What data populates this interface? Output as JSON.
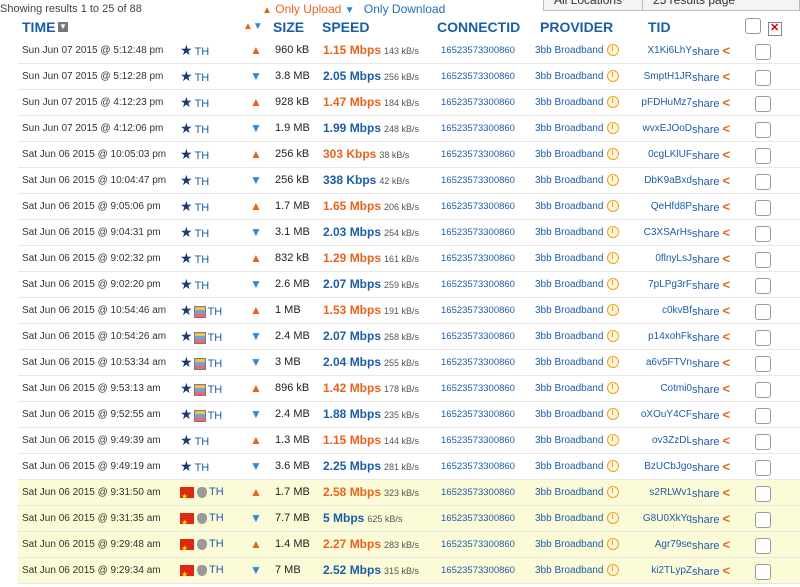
{
  "topbar": {
    "showing": "Showing results 1 to 25 of 88",
    "only_upload": "Only Upload",
    "only_download": "Only Download",
    "btn1": "All Locations",
    "btn2": "25 results page"
  },
  "header": {
    "time": "TIME",
    "size": "SIZE",
    "speed": "SPEED",
    "connectid": "CONNECTID",
    "provider": "PROVIDER",
    "tid": "TID"
  },
  "colors": {
    "upload": "#e8641b",
    "download": "#1a5ea8",
    "accent": "#1a5ea8",
    "cn_row_bg": "#fbfbd8"
  },
  "rows": [
    {
      "time": "Sun Jun 07 2015 @ 5:12:48 pm",
      "platform": "star",
      "country": "TH",
      "dir": "up",
      "size": "960 kB",
      "speed": "1.15 Mbps",
      "kbs": "143 kB/s",
      "conn": "16523573300860",
      "provider": "3bb Broadband",
      "tid": "X1Ki6LhY",
      "share": "share"
    },
    {
      "time": "Sun Jun 07 2015 @ 5:12:28 pm",
      "platform": "star",
      "country": "TH",
      "dir": "down",
      "size": "3.8 MB",
      "speed": "2.05 Mbps",
      "kbs": "256 kB/s",
      "conn": "16523573300860",
      "provider": "3bb Broadband",
      "tid": "SmptH1JR",
      "share": "share"
    },
    {
      "time": "Sun Jun 07 2015 @ 4:12:23 pm",
      "platform": "star",
      "country": "TH",
      "dir": "up",
      "size": "928 kB",
      "speed": "1.47 Mbps",
      "kbs": "184 kB/s",
      "conn": "16523573300860",
      "provider": "3bb Broadband",
      "tid": "pFDHuMz7",
      "share": "share"
    },
    {
      "time": "Sun Jun 07 2015 @ 4:12:06 pm",
      "platform": "star",
      "country": "TH",
      "dir": "down",
      "size": "1.9 MB",
      "speed": "1.99 Mbps",
      "kbs": "248 kB/s",
      "conn": "16523573300860",
      "provider": "3bb Broadband",
      "tid": "wvxEJOoD",
      "share": "share"
    },
    {
      "time": "Sat Jun 06 2015 @ 10:05:03 pm",
      "platform": "star",
      "country": "TH",
      "dir": "up",
      "size": "256 kB",
      "speed": "303 Kbps",
      "kbs": "38 kB/s",
      "conn": "16523573300860",
      "provider": "3bb Broadband",
      "tid": "0cgLKlUF",
      "share": "share"
    },
    {
      "time": "Sat Jun 06 2015 @ 10:04:47 pm",
      "platform": "star",
      "country": "TH",
      "dir": "down",
      "size": "256 kB",
      "speed": "338 Kbps",
      "kbs": "42 kB/s",
      "conn": "16523573300860",
      "provider": "3bb Broadband",
      "tid": "DbK9aBxd",
      "share": "share"
    },
    {
      "time": "Sat Jun 06 2015 @ 9:05:06 pm",
      "platform": "star",
      "country": "TH",
      "dir": "up",
      "size": "1.7 MB",
      "speed": "1.65 Mbps",
      "kbs": "206 kB/s",
      "conn": "16523573300860",
      "provider": "3bb Broadband",
      "tid": "QeHfd8P",
      "share": "share"
    },
    {
      "time": "Sat Jun 06 2015 @ 9:04:31 pm",
      "platform": "star",
      "country": "TH",
      "dir": "down",
      "size": "3.1 MB",
      "speed": "2.03 Mbps",
      "kbs": "254 kB/s",
      "conn": "16523573300860",
      "provider": "3bb Broadband",
      "tid": "C3XSArHs",
      "share": "share"
    },
    {
      "time": "Sat Jun 06 2015 @ 9:02:32 pm",
      "platform": "star",
      "country": "TH",
      "dir": "up",
      "size": "832 kB",
      "speed": "1.29 Mbps",
      "kbs": "161 kB/s",
      "conn": "16523573300860",
      "provider": "3bb Broadband",
      "tid": "0flnyLsJ",
      "share": "share"
    },
    {
      "time": "Sat Jun 06 2015 @ 9:02:20 pm",
      "platform": "star",
      "country": "TH",
      "dir": "down",
      "size": "2.6 MB",
      "speed": "2.07 Mbps",
      "kbs": "259 kB/s",
      "conn": "16523573300860",
      "provider": "3bb Broadband",
      "tid": "7pLPg3rF",
      "share": "share"
    },
    {
      "time": "Sat Jun 06 2015 @ 10:54:46 am",
      "platform": "star-folder",
      "country": "TH",
      "dir": "up",
      "size": "1 MB",
      "speed": "1.53 Mbps",
      "kbs": "191 kB/s",
      "conn": "16523573300860",
      "provider": "3bb Broadband",
      "tid": "c0kvBf",
      "share": "share"
    },
    {
      "time": "Sat Jun 06 2015 @ 10:54:26 am",
      "platform": "star-folder",
      "country": "TH",
      "dir": "down",
      "size": "2.4 MB",
      "speed": "2.07 Mbps",
      "kbs": "258 kB/s",
      "conn": "16523573300860",
      "provider": "3bb Broadband",
      "tid": "p14xohFk",
      "share": "share"
    },
    {
      "time": "Sat Jun 06 2015 @ 10:53:34 am",
      "platform": "star-folder",
      "country": "TH",
      "dir": "down",
      "size": "3 MB",
      "speed": "2.04 Mbps",
      "kbs": "255 kB/s",
      "conn": "16523573300860",
      "provider": "3bb Broadband",
      "tid": "a6v5FTVn",
      "share": "share"
    },
    {
      "time": "Sat Jun 06 2015 @ 9:53:13 am",
      "platform": "star-folder",
      "country": "TH",
      "dir": "up",
      "size": "896 kB",
      "speed": "1.42 Mbps",
      "kbs": "178 kB/s",
      "conn": "16523573300860",
      "provider": "3bb Broadband",
      "tid": "Cotmi0",
      "share": "share"
    },
    {
      "time": "Sat Jun 06 2015 @ 9:52:55 am",
      "platform": "star-folder",
      "country": "TH",
      "dir": "down",
      "size": "2.4 MB",
      "speed": "1.88 Mbps",
      "kbs": "235 kB/s",
      "conn": "16523573300860",
      "provider": "3bb Broadband",
      "tid": "oXOuY4CF",
      "share": "share"
    },
    {
      "time": "Sat Jun 06 2015 @ 9:49:39 am",
      "platform": "star",
      "country": "TH",
      "dir": "up",
      "size": "1.3 MB",
      "speed": "1.15 Mbps",
      "kbs": "144 kB/s",
      "conn": "16523573300860",
      "provider": "3bb Broadband",
      "tid": "ov3ZzDL",
      "share": "share"
    },
    {
      "time": "Sat Jun 06 2015 @ 9:49:19 am",
      "platform": "star",
      "country": "TH",
      "dir": "down",
      "size": "3.6 MB",
      "speed": "2.25 Mbps",
      "kbs": "281 kB/s",
      "conn": "16523573300860",
      "provider": "3bb Broadband",
      "tid": "BzUCbJgo",
      "share": "share"
    },
    {
      "time": "Sat Jun 06 2015 @ 9:31:50 am",
      "platform": "flag-apple",
      "country": "TH",
      "dir": "up",
      "size": "1.7 MB",
      "speed": "2.58 Mbps",
      "kbs": "323 kB/s",
      "conn": "16523573300860",
      "provider": "3bb Broadband",
      "tid": "s2RLWv1",
      "share": "share"
    },
    {
      "time": "Sat Jun 06 2015 @ 9:31:35 am",
      "platform": "flag-apple",
      "country": "TH",
      "dir": "down",
      "size": "7.7 MB",
      "speed": "5 Mbps",
      "kbs": "625 kB/s",
      "conn": "16523573300860",
      "provider": "3bb Broadband",
      "tid": "G8U0XkYq",
      "share": "share"
    },
    {
      "time": "Sat Jun 06 2015 @ 9:29:48 am",
      "platform": "flag-apple",
      "country": "TH",
      "dir": "up",
      "size": "1.4 MB",
      "speed": "2.27 Mbps",
      "kbs": "283 kB/s",
      "conn": "16523573300860",
      "provider": "3bb Broadband",
      "tid": "Agr79se",
      "share": "share"
    },
    {
      "time": "Sat Jun 06 2015 @ 9:29:34 am",
      "platform": "flag-apple",
      "country": "TH",
      "dir": "down",
      "size": "7 MB",
      "speed": "2.52 Mbps",
      "kbs": "315 kB/s",
      "conn": "16523573300860",
      "provider": "3bb Broadband",
      "tid": "ki2TLypZ",
      "share": "share"
    }
  ]
}
